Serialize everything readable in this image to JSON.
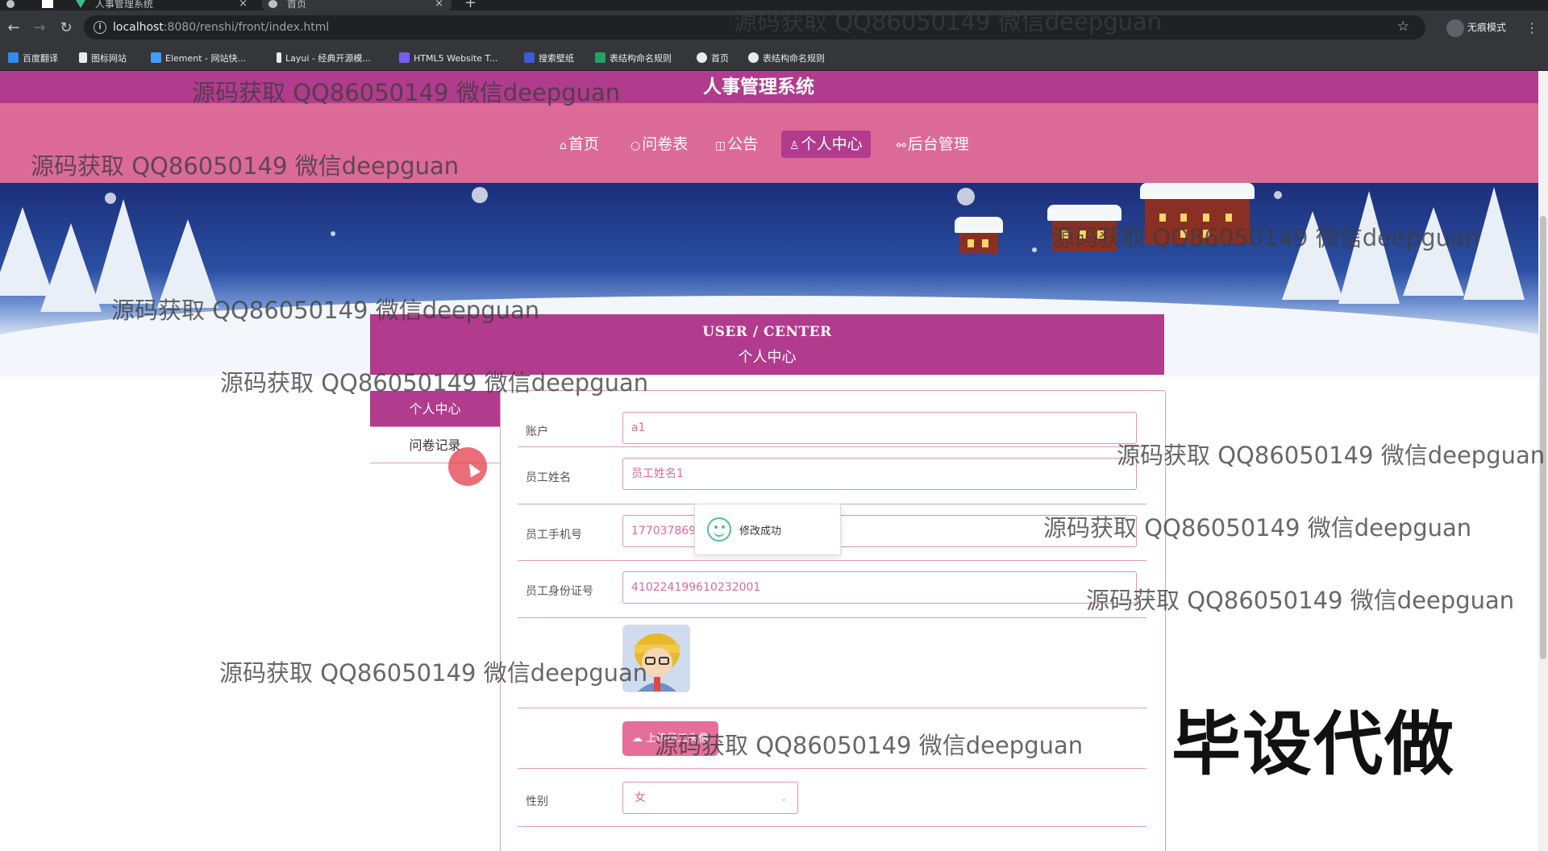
{
  "browser": {
    "tabs": [
      {
        "label": "人事管理系统",
        "active": false
      },
      {
        "label": "首页",
        "active": true
      }
    ],
    "url_host": "localhost",
    "url_rest": ":8080/renshi/front/index.html",
    "incognito_label": "无痕模式",
    "bookmarks": [
      "百度翻译",
      "图标网站",
      "Element - 网站快...",
      "Layui - 经典开源模...",
      "HTML5 Website T...",
      "搜索壁纸",
      "表结构命名规则",
      "首页",
      "表结构命名规则"
    ]
  },
  "site": {
    "title": "人事管理系统",
    "nav": [
      {
        "label": "首页",
        "icon": "home-icon",
        "active": false
      },
      {
        "label": "问卷表",
        "icon": "survey-icon",
        "active": false
      },
      {
        "label": "公告",
        "icon": "notice-icon",
        "active": false
      },
      {
        "label": "个人中心",
        "icon": "user-icon",
        "active": true
      },
      {
        "label": "后台管理",
        "icon": "link-icon",
        "active": false
      }
    ],
    "carousel_active_index": 1
  },
  "center": {
    "title_en": "USER / CENTER",
    "title_cn": "个人中心",
    "side_items": [
      {
        "label": "个人中心",
        "active": true
      },
      {
        "label": "问卷记录",
        "active": false
      }
    ]
  },
  "form": {
    "account_label": "账户",
    "account_value": "a1",
    "name_label": "员工姓名",
    "name_value": "员工姓名1",
    "phone_label": "员工手机号",
    "phone_value": "177037869",
    "idcard_label": "员工身份证号",
    "idcard_value": "410224199610232001",
    "upload_label": "上传员工头像",
    "gender_label": "性别",
    "gender_value": "女"
  },
  "toast": {
    "message": "修改成功"
  },
  "overlay": {
    "watermark_text": "源码获取 QQ86050149 微信deepguan",
    "stamp_text": "毕设代做"
  },
  "colors": {
    "header": "#b13b8c",
    "nav": "#dc6a97",
    "accent_border": "#e39bb9",
    "success": "#4fc08d"
  }
}
